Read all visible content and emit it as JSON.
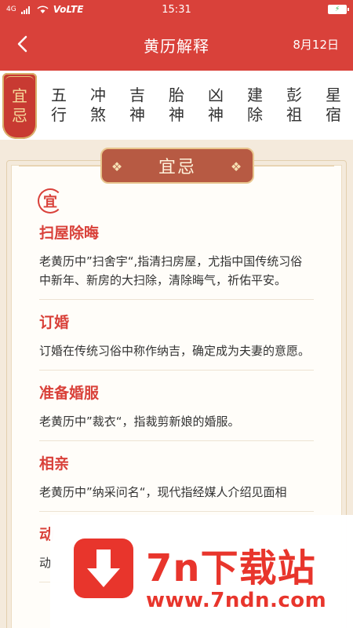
{
  "status_bar": {
    "network_left": "4G",
    "wifi_label": "VoLTE",
    "time": "15:31"
  },
  "header": {
    "title": "黄历解释",
    "date": "8月12日"
  },
  "tabs": [
    {
      "label": [
        "宜",
        "忌"
      ],
      "active": true
    },
    {
      "label": [
        "五",
        "行"
      ],
      "active": false
    },
    {
      "label": [
        "冲",
        "煞"
      ],
      "active": false
    },
    {
      "label": [
        "吉",
        "神"
      ],
      "active": false
    },
    {
      "label": [
        "胎",
        "神"
      ],
      "active": false
    },
    {
      "label": [
        "凶",
        "神"
      ],
      "active": false
    },
    {
      "label": [
        "建",
        "除"
      ],
      "active": false
    },
    {
      "label": [
        "彭",
        "祖"
      ],
      "active": false
    },
    {
      "label": [
        "星",
        "宿"
      ],
      "active": false
    }
  ],
  "section": {
    "banner_title": "宜忌",
    "badge": "宜"
  },
  "entries": [
    {
      "title": "扫屋除晦",
      "text": "老黄历中”扫舍宇“,指清扫房屋，尤指中国传统习俗中新年、新房的大扫除，清除晦气，祈佑平安。"
    },
    {
      "title": "订婚",
      "text": "订婚在传统习俗中称作纳吉，确定成为夫妻的意愿。"
    },
    {
      "title": "准备婚服",
      "text": "老黄历中”裁衣“，指裁剪新娘的婚服。"
    },
    {
      "title": "相亲",
      "text": "老黄历中”纳采问名“，现代指经媒人介绍见面相"
    },
    {
      "title": "动",
      "text": "动"
    }
  ],
  "watermark": {
    "name": "7n下载站",
    "url": "www.7ndn.com"
  },
  "colors": {
    "primary": "#d9413a",
    "gold": "#f5d99b",
    "banner": "#b75a43"
  }
}
